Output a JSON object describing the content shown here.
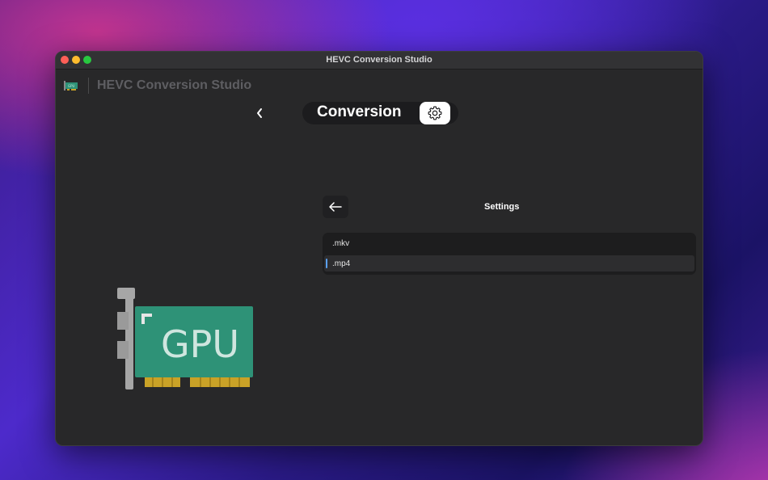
{
  "window": {
    "title": "HEVC Conversion Studio"
  },
  "app": {
    "name": "HEVC Conversion Studio",
    "logo_icon": "gpu-card-icon"
  },
  "toolbar": {
    "back_icon": "chevron-left-icon",
    "segment_label": "Conversion",
    "settings_icon": "gear-icon"
  },
  "artwork": {
    "label": "GPU",
    "colors": {
      "board": "#2e9277",
      "bracket": "#a6a6a6",
      "pins": "#c9a227"
    }
  },
  "settings": {
    "title": "Settings",
    "back_icon": "arrow-left-icon",
    "items": [
      {
        "label": ".mkv",
        "selected": false
      },
      {
        "label": ".mp4",
        "selected": true
      }
    ]
  }
}
